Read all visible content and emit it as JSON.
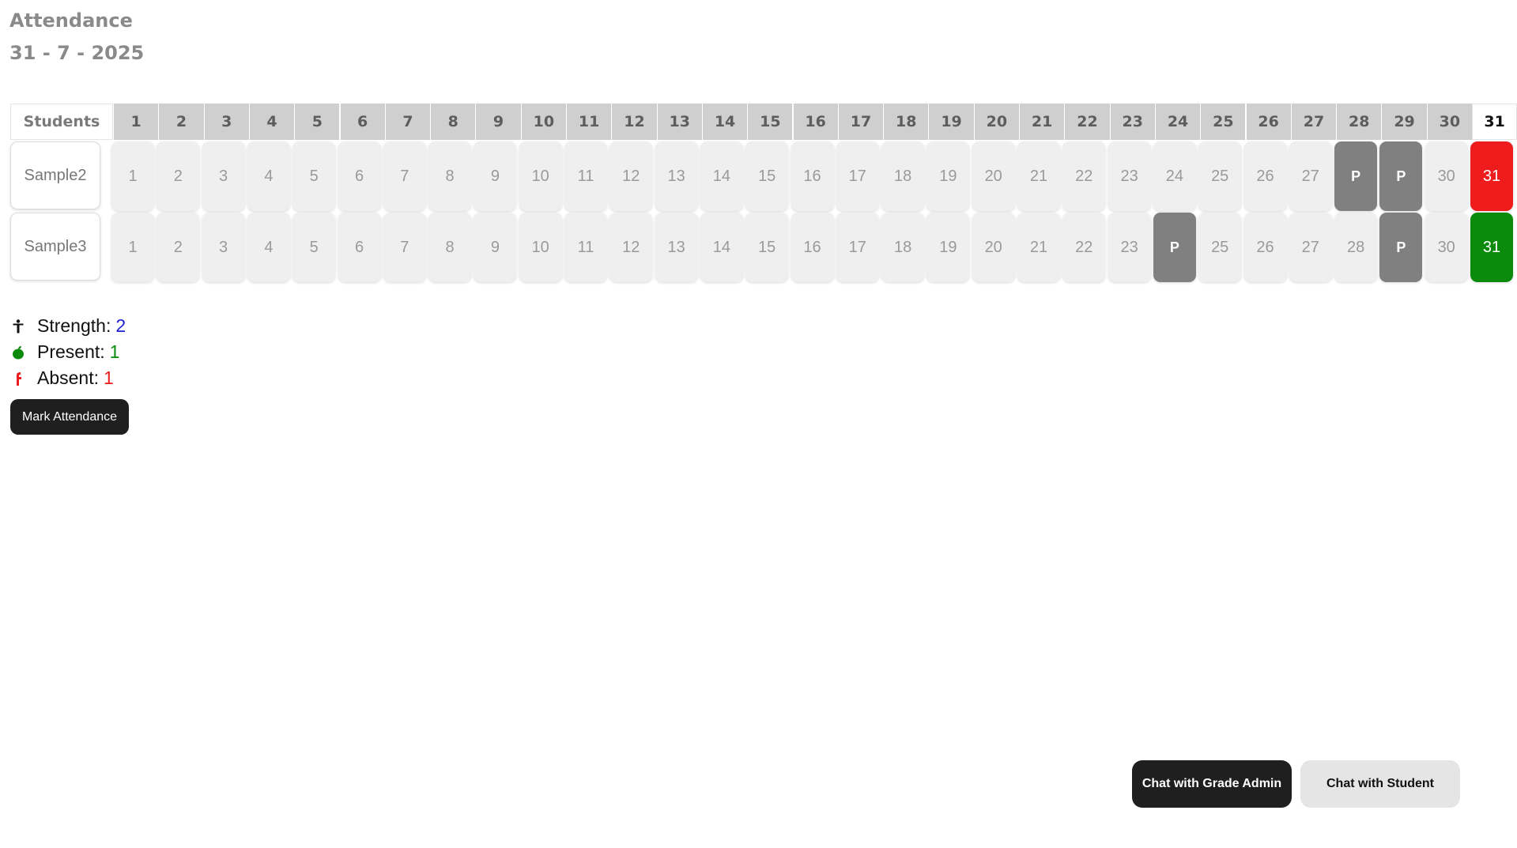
{
  "page": {
    "title": "Attendance",
    "date": "31 - 7 - 2025"
  },
  "table": {
    "students_header": "Students",
    "days": [
      "1",
      "2",
      "3",
      "4",
      "5",
      "6",
      "7",
      "8",
      "9",
      "10",
      "11",
      "12",
      "13",
      "14",
      "15",
      "16",
      "17",
      "18",
      "19",
      "20",
      "21",
      "22",
      "23",
      "24",
      "25",
      "26",
      "27",
      "28",
      "29",
      "30",
      "31"
    ],
    "today": "31",
    "rows": [
      {
        "name": "Sample2",
        "cells": [
          "1",
          "2",
          "3",
          "4",
          "5",
          "6",
          "7",
          "8",
          "9",
          "10",
          "11",
          "12",
          "13",
          "14",
          "15",
          "16",
          "17",
          "18",
          "19",
          "20",
          "21",
          "22",
          "23",
          "24",
          "25",
          "26",
          "27",
          "P",
          "P",
          "30",
          "31"
        ],
        "states": [
          "",
          "",
          "",
          "",
          "",
          "",
          "",
          "",
          "",
          "",
          "",
          "",
          "",
          "",
          "",
          "",
          "",
          "",
          "",
          "",
          "",
          "",
          "",
          "",
          "",
          "",
          "",
          "present",
          "present",
          "",
          "absent"
        ]
      },
      {
        "name": "Sample3",
        "cells": [
          "1",
          "2",
          "3",
          "4",
          "5",
          "6",
          "7",
          "8",
          "9",
          "10",
          "11",
          "12",
          "13",
          "14",
          "15",
          "16",
          "17",
          "18",
          "19",
          "20",
          "21",
          "22",
          "23",
          "P",
          "25",
          "26",
          "27",
          "28",
          "P",
          "30",
          "31"
        ],
        "states": [
          "",
          "",
          "",
          "",
          "",
          "",
          "",
          "",
          "",
          "",
          "",
          "",
          "",
          "",
          "",
          "",
          "",
          "",
          "",
          "",
          "",
          "",
          "",
          "present",
          "",
          "",
          "",
          "",
          "present",
          "",
          "attended"
        ]
      }
    ]
  },
  "stats": {
    "strength_label": "Strength:",
    "strength_value": "2",
    "present_label": "Present:",
    "present_value": "1",
    "absent_label": "Absent:",
    "absent_value": "1",
    "icons": {
      "strength": "person-icon",
      "present": "apple-icon",
      "absent": "absent-icon"
    },
    "colors": {
      "strength_value": "#1f1fd6",
      "present_value": "#0b8a0b",
      "absent_value": "#ee1c1c"
    }
  },
  "actions": {
    "mark_attendance": "Mark Attendance",
    "chat_admin": "Chat with Grade Admin",
    "chat_student": "Chat with Student"
  },
  "colors": {
    "present_cell": "#808080",
    "absent_cell": "#ee1c1c",
    "attended_cell": "#0b8a0b",
    "default_cell": "#efefef",
    "header_bg": "#cfcfcf"
  }
}
